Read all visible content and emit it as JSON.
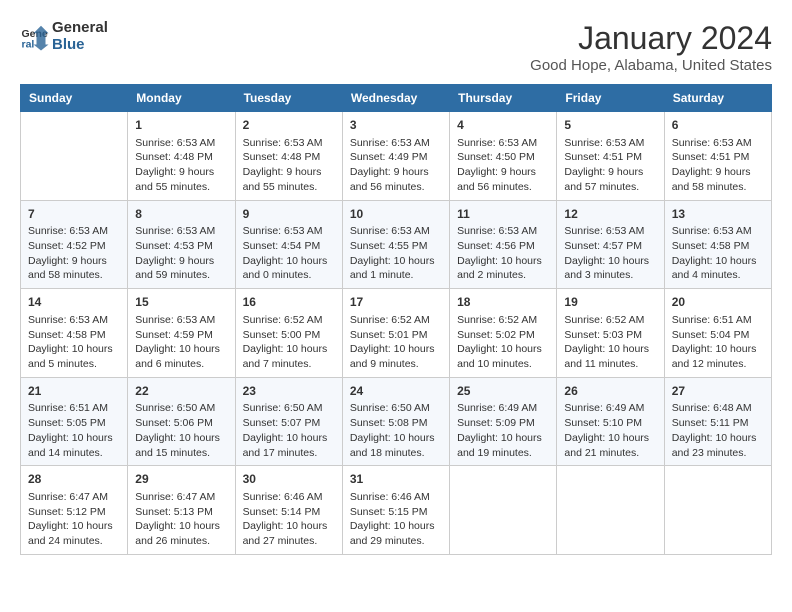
{
  "app": {
    "logo_line1": "General",
    "logo_line2": "Blue"
  },
  "header": {
    "title": "January 2024",
    "subtitle": "Good Hope, Alabama, United States"
  },
  "calendar": {
    "weekdays": [
      "Sunday",
      "Monday",
      "Tuesday",
      "Wednesday",
      "Thursday",
      "Friday",
      "Saturday"
    ],
    "weeks": [
      [
        {
          "day": "",
          "info": ""
        },
        {
          "day": "1",
          "info": "Sunrise: 6:53 AM\nSunset: 4:48 PM\nDaylight: 9 hours\nand 55 minutes."
        },
        {
          "day": "2",
          "info": "Sunrise: 6:53 AM\nSunset: 4:48 PM\nDaylight: 9 hours\nand 55 minutes."
        },
        {
          "day": "3",
          "info": "Sunrise: 6:53 AM\nSunset: 4:49 PM\nDaylight: 9 hours\nand 56 minutes."
        },
        {
          "day": "4",
          "info": "Sunrise: 6:53 AM\nSunset: 4:50 PM\nDaylight: 9 hours\nand 56 minutes."
        },
        {
          "day": "5",
          "info": "Sunrise: 6:53 AM\nSunset: 4:51 PM\nDaylight: 9 hours\nand 57 minutes."
        },
        {
          "day": "6",
          "info": "Sunrise: 6:53 AM\nSunset: 4:51 PM\nDaylight: 9 hours\nand 58 minutes."
        }
      ],
      [
        {
          "day": "7",
          "info": "Sunrise: 6:53 AM\nSunset: 4:52 PM\nDaylight: 9 hours\nand 58 minutes."
        },
        {
          "day": "8",
          "info": "Sunrise: 6:53 AM\nSunset: 4:53 PM\nDaylight: 9 hours\nand 59 minutes."
        },
        {
          "day": "9",
          "info": "Sunrise: 6:53 AM\nSunset: 4:54 PM\nDaylight: 10 hours\nand 0 minutes."
        },
        {
          "day": "10",
          "info": "Sunrise: 6:53 AM\nSunset: 4:55 PM\nDaylight: 10 hours\nand 1 minute."
        },
        {
          "day": "11",
          "info": "Sunrise: 6:53 AM\nSunset: 4:56 PM\nDaylight: 10 hours\nand 2 minutes."
        },
        {
          "day": "12",
          "info": "Sunrise: 6:53 AM\nSunset: 4:57 PM\nDaylight: 10 hours\nand 3 minutes."
        },
        {
          "day": "13",
          "info": "Sunrise: 6:53 AM\nSunset: 4:58 PM\nDaylight: 10 hours\nand 4 minutes."
        }
      ],
      [
        {
          "day": "14",
          "info": "Sunrise: 6:53 AM\nSunset: 4:58 PM\nDaylight: 10 hours\nand 5 minutes."
        },
        {
          "day": "15",
          "info": "Sunrise: 6:53 AM\nSunset: 4:59 PM\nDaylight: 10 hours\nand 6 minutes."
        },
        {
          "day": "16",
          "info": "Sunrise: 6:52 AM\nSunset: 5:00 PM\nDaylight: 10 hours\nand 7 minutes."
        },
        {
          "day": "17",
          "info": "Sunrise: 6:52 AM\nSunset: 5:01 PM\nDaylight: 10 hours\nand 9 minutes."
        },
        {
          "day": "18",
          "info": "Sunrise: 6:52 AM\nSunset: 5:02 PM\nDaylight: 10 hours\nand 10 minutes."
        },
        {
          "day": "19",
          "info": "Sunrise: 6:52 AM\nSunset: 5:03 PM\nDaylight: 10 hours\nand 11 minutes."
        },
        {
          "day": "20",
          "info": "Sunrise: 6:51 AM\nSunset: 5:04 PM\nDaylight: 10 hours\nand 12 minutes."
        }
      ],
      [
        {
          "day": "21",
          "info": "Sunrise: 6:51 AM\nSunset: 5:05 PM\nDaylight: 10 hours\nand 14 minutes."
        },
        {
          "day": "22",
          "info": "Sunrise: 6:50 AM\nSunset: 5:06 PM\nDaylight: 10 hours\nand 15 minutes."
        },
        {
          "day": "23",
          "info": "Sunrise: 6:50 AM\nSunset: 5:07 PM\nDaylight: 10 hours\nand 17 minutes."
        },
        {
          "day": "24",
          "info": "Sunrise: 6:50 AM\nSunset: 5:08 PM\nDaylight: 10 hours\nand 18 minutes."
        },
        {
          "day": "25",
          "info": "Sunrise: 6:49 AM\nSunset: 5:09 PM\nDaylight: 10 hours\nand 19 minutes."
        },
        {
          "day": "26",
          "info": "Sunrise: 6:49 AM\nSunset: 5:10 PM\nDaylight: 10 hours\nand 21 minutes."
        },
        {
          "day": "27",
          "info": "Sunrise: 6:48 AM\nSunset: 5:11 PM\nDaylight: 10 hours\nand 23 minutes."
        }
      ],
      [
        {
          "day": "28",
          "info": "Sunrise: 6:47 AM\nSunset: 5:12 PM\nDaylight: 10 hours\nand 24 minutes."
        },
        {
          "day": "29",
          "info": "Sunrise: 6:47 AM\nSunset: 5:13 PM\nDaylight: 10 hours\nand 26 minutes."
        },
        {
          "day": "30",
          "info": "Sunrise: 6:46 AM\nSunset: 5:14 PM\nDaylight: 10 hours\nand 27 minutes."
        },
        {
          "day": "31",
          "info": "Sunrise: 6:46 AM\nSunset: 5:15 PM\nDaylight: 10 hours\nand 29 minutes."
        },
        {
          "day": "",
          "info": ""
        },
        {
          "day": "",
          "info": ""
        },
        {
          "day": "",
          "info": ""
        }
      ]
    ]
  }
}
